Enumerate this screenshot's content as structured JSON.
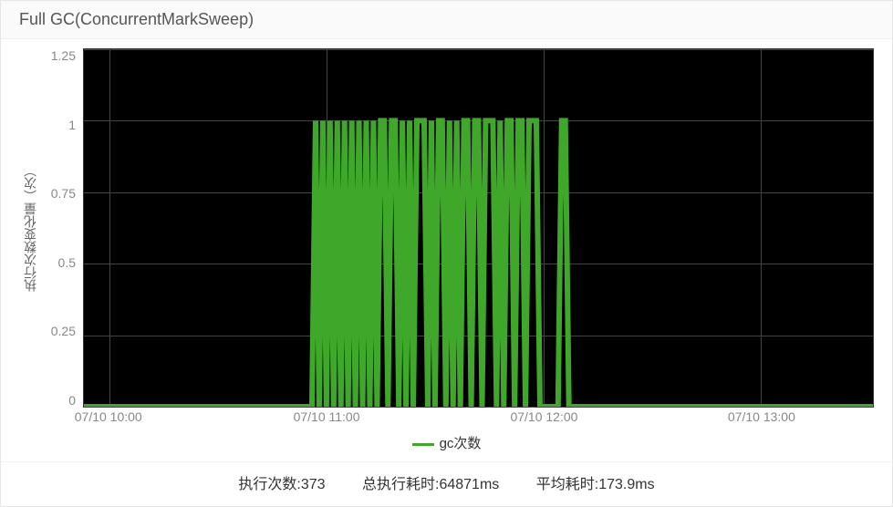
{
  "title": "Full GC(ConcurrentMarkSweep)",
  "ylabel": "执行次数变化量（次）",
  "legend_label": "gc次数",
  "colors": {
    "series": "#3fa82a"
  },
  "y_ticks": [
    "1.25",
    "1",
    "0.75",
    "0.5",
    "0.25",
    "0"
  ],
  "x_ticks": [
    {
      "label": "07/10 10:00",
      "pos_pct": 3.2
    },
    {
      "label": "07/10 11:00",
      "pos_pct": 30.8
    },
    {
      "label": "07/10 12:00",
      "pos_pct": 58.3
    },
    {
      "label": "07/10 13:00",
      "pos_pct": 85.8
    }
  ],
  "stats": {
    "exec_count": "执行次数:373",
    "total_time": "总执行耗时:64871ms",
    "avg_time": "平均耗时:173.9ms"
  },
  "chart_data": {
    "type": "line",
    "title": "Full GC(ConcurrentMarkSweep)",
    "xlabel": "",
    "ylabel": "执行次数变化量（次）",
    "ylim": [
      0,
      1.25
    ],
    "x_range": [
      "07/10 09:53",
      "07/10 13:31"
    ],
    "series": [
      {
        "name": "gc次数",
        "color": "#3fa82a",
        "points": [
          {
            "x": "07/10 09:53",
            "y": 0
          },
          {
            "x": "07/10 10:56",
            "y": 0
          },
          {
            "x": "07/10 10:57",
            "y": 1
          },
          {
            "x": "07/10 10:58",
            "y": 0
          },
          {
            "x": "07/10 10:59",
            "y": 1
          },
          {
            "x": "07/10 11:00",
            "y": 0
          },
          {
            "x": "07/10 11:01",
            "y": 1
          },
          {
            "x": "07/10 11:02",
            "y": 0
          },
          {
            "x": "07/10 11:03",
            "y": 1
          },
          {
            "x": "07/10 11:04",
            "y": 0
          },
          {
            "x": "07/10 11:05",
            "y": 1
          },
          {
            "x": "07/10 11:06",
            "y": 0
          },
          {
            "x": "07/10 11:07",
            "y": 1
          },
          {
            "x": "07/10 11:08",
            "y": 0
          },
          {
            "x": "07/10 11:09",
            "y": 1
          },
          {
            "x": "07/10 11:10",
            "y": 0
          },
          {
            "x": "07/10 11:11",
            "y": 1
          },
          {
            "x": "07/10 11:12",
            "y": 0
          },
          {
            "x": "07/10 11:13",
            "y": 1
          },
          {
            "x": "07/10 11:14",
            "y": 0
          },
          {
            "x": "07/10 11:15",
            "y": 1
          },
          {
            "x": "07/10 11:16",
            "y": 1
          },
          {
            "x": "07/10 11:17",
            "y": 0
          },
          {
            "x": "07/10 11:18",
            "y": 1
          },
          {
            "x": "07/10 11:19",
            "y": 1
          },
          {
            "x": "07/10 11:20",
            "y": 0
          },
          {
            "x": "07/10 11:21",
            "y": 1
          },
          {
            "x": "07/10 11:22",
            "y": 0
          },
          {
            "x": "07/10 11:23",
            "y": 1
          },
          {
            "x": "07/10 11:24",
            "y": 0
          },
          {
            "x": "07/10 11:25",
            "y": 1
          },
          {
            "x": "07/10 11:26",
            "y": 1
          },
          {
            "x": "07/10 11:27",
            "y": 1
          },
          {
            "x": "07/10 11:28",
            "y": 0
          },
          {
            "x": "07/10 11:29",
            "y": 1
          },
          {
            "x": "07/10 11:30",
            "y": 0
          },
          {
            "x": "07/10 11:31",
            "y": 1
          },
          {
            "x": "07/10 11:32",
            "y": 1
          },
          {
            "x": "07/10 11:33",
            "y": 0
          },
          {
            "x": "07/10 11:34",
            "y": 1
          },
          {
            "x": "07/10 11:35",
            "y": 0
          },
          {
            "x": "07/10 11:36",
            "y": 1
          },
          {
            "x": "07/10 11:37",
            "y": 0
          },
          {
            "x": "07/10 11:38",
            "y": 1
          },
          {
            "x": "07/10 11:39",
            "y": 1
          },
          {
            "x": "07/10 11:40",
            "y": 0
          },
          {
            "x": "07/10 11:41",
            "y": 1
          },
          {
            "x": "07/10 11:42",
            "y": 1
          },
          {
            "x": "07/10 11:43",
            "y": 0
          },
          {
            "x": "07/10 11:44",
            "y": 1
          },
          {
            "x": "07/10 11:45",
            "y": 1
          },
          {
            "x": "07/10 11:46",
            "y": 1
          },
          {
            "x": "07/10 11:47",
            "y": 0
          },
          {
            "x": "07/10 11:48",
            "y": 1
          },
          {
            "x": "07/10 11:49",
            "y": 0
          },
          {
            "x": "07/10 11:50",
            "y": 1
          },
          {
            "x": "07/10 11:51",
            "y": 1
          },
          {
            "x": "07/10 11:52",
            "y": 0
          },
          {
            "x": "07/10 11:53",
            "y": 1
          },
          {
            "x": "07/10 11:54",
            "y": 1
          },
          {
            "x": "07/10 11:55",
            "y": 0
          },
          {
            "x": "07/10 11:56",
            "y": 1
          },
          {
            "x": "07/10 11:57",
            "y": 1
          },
          {
            "x": "07/10 11:58",
            "y": 1
          },
          {
            "x": "07/10 11:59",
            "y": 0
          },
          {
            "x": "07/10 12:04",
            "y": 0
          },
          {
            "x": "07/10 12:05",
            "y": 1
          },
          {
            "x": "07/10 12:06",
            "y": 1
          },
          {
            "x": "07/10 12:07",
            "y": 0
          },
          {
            "x": "07/10 13:31",
            "y": 0
          }
        ]
      }
    ]
  }
}
